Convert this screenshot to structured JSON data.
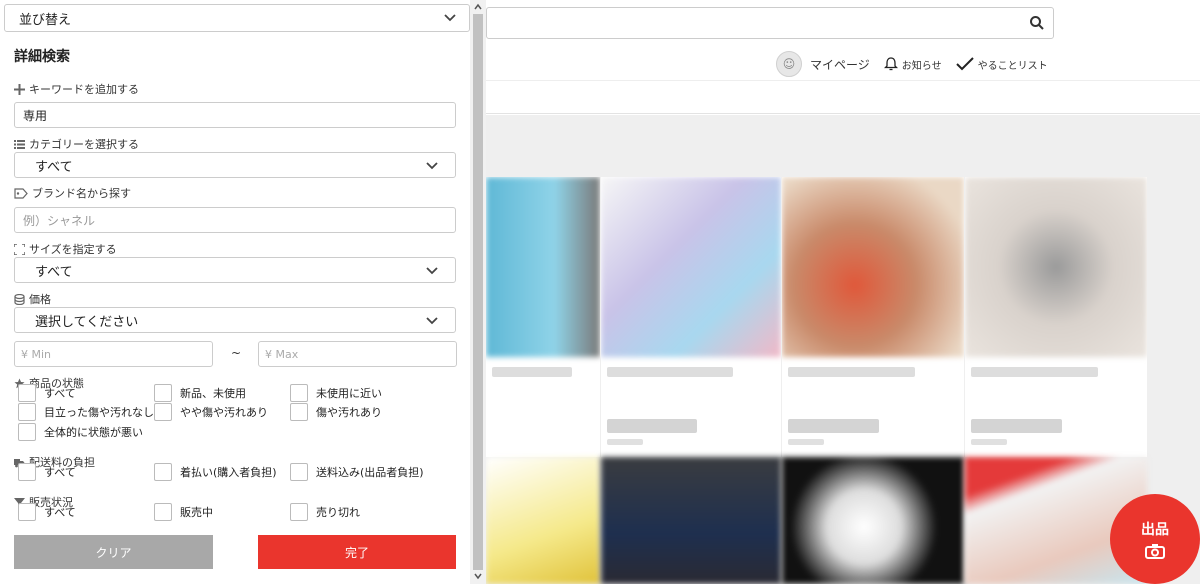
{
  "panel": {
    "sort_label": "並び替え",
    "title": "詳細検索",
    "keyword_label": "キーワードを追加する",
    "keyword_value": "専用",
    "category_label": "カテゴリーを選択する",
    "category_value": "すべて",
    "brand_label": "ブランド名から探す",
    "brand_placeholder": "例）シャネル",
    "size_label": "サイズを指定する",
    "size_value": "すべて",
    "price_label": "価格",
    "price_value": "選択してください",
    "price_min_placeholder": "¥ Min",
    "price_tilde": "~",
    "price_max_placeholder": "¥ Max",
    "condition_label": "商品の状態",
    "condition_options": [
      "すべて",
      "新品、未使用",
      "未使用に近い",
      "目立った傷や汚れなし",
      "やや傷や汚れあり",
      "傷や汚れあり",
      "全体的に状態が悪い"
    ],
    "shipping_label": "配送料の負担",
    "shipping_options": [
      "すべて",
      "着払い(購入者負担)",
      "送料込み(出品者負担)"
    ],
    "status_label": "販売状況",
    "status_options": [
      "すべて",
      "販売中",
      "売り切れ"
    ],
    "clear_button": "クリア",
    "done_button": "完了"
  },
  "header": {
    "mypage": "マイページ",
    "notifications": "お知らせ",
    "todo": "やることリスト"
  },
  "fab": {
    "label": "出品"
  },
  "colors": {
    "accent": "#ea352d",
    "clear_button": "#a8a8a8"
  }
}
